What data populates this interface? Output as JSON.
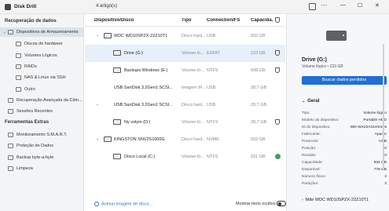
{
  "app": {
    "title": "Disk Drill",
    "articles": "4 artigo(s)"
  },
  "sidebar": {
    "sections": [
      {
        "label": "Recuperação de dados"
      },
      {
        "label": "Ferramentas Extras"
      }
    ],
    "items": [
      {
        "label": "Dispositivos de Armazenamento"
      },
      {
        "label": "Discos de hardware"
      },
      {
        "label": "Volumes Lógicos"
      },
      {
        "label": "RAIDs"
      },
      {
        "label": "NAS & Linux via SSH"
      },
      {
        "label": "Outro"
      },
      {
        "label": "Recuperação Avançada da Câm..."
      },
      {
        "label": "Sessões Recentes"
      },
      {
        "label": "Monitoramento S.M.A.R.T."
      },
      {
        "label": "Proteção de Dados"
      },
      {
        "label": "Backup byte-a-byte"
      },
      {
        "label": "Limpeza"
      }
    ]
  },
  "table": {
    "headers": {
      "device": "Dispositivo/Disco",
      "type": "Tipo",
      "connection": "Connection/FS",
      "capacity": "Capacida..."
    },
    "rows": [
      {
        "name": "WDC WD10SPZX-22Z10T1",
        "type": "Disco hard...",
        "conn": "USB",
        "cap": "932 GB"
      },
      {
        "name": "Drive (G:)",
        "type": "Volume ló...",
        "conn": "EXFAT",
        "cap": "233 GB"
      },
      {
        "name": "Backups Windows (E:)",
        "type": "Volume ló...",
        "conn": "NTFS",
        "cap": "698 GB"
      },
      {
        "name": "USB  SanDisk 3.2Gen1 SCSI...",
        "type": "Imagem M...",
        "conn": "USB",
        "cap": "28,7 GB"
      },
      {
        "name": "USB  SanDisk 3.2Gen1 SCSI...",
        "type": "Disco hard...",
        "conn": "USB",
        "cap": "28,7 GB"
      },
      {
        "name": "Ny volym (D:)",
        "type": "Volume ló...",
        "conn": "NTFS",
        "cap": "28,7 GB"
      },
      {
        "name": "KINGSTON SNV2S1000G",
        "type": "Disco hard...",
        "conn": "NVME",
        "cap": "932 GB"
      },
      {
        "name": "Disco Local (C:)",
        "type": "Volume ló...",
        "conn": "NTFS",
        "cap": "931 GB"
      }
    ],
    "add_image": "Anexar imagem de disco...",
    "show_hidden": "Mostrar itens ocultos"
  },
  "detail": {
    "title": "Drive (G:)",
    "subtitle": "Volume lógico • 233 GB",
    "button": "Buscar dados perdidos",
    "section": "Geral",
    "props": [
      {
        "k": "Tipo:",
        "v": "Volume lógico"
      },
      {
        "k": "Modelo do dispositivo:",
        "v": "Portable HDD"
      },
      {
        "k": "ID do dispositivo:",
        "v": "WD-WX22A31HS4X5"
      },
      {
        "k": "Fabricante:",
        "v": "Apacer"
      },
      {
        "k": "Protocolo:",
        "v": "USB"
      },
      {
        "k": "Posição:",
        "v": "0"
      },
      {
        "k": "Revisão:",
        "v": "0"
      },
      {
        "k": "Capacidade:",
        "v": "932 GB"
      },
      {
        "k": "Disponível:",
        "v": "779 GB"
      },
      {
        "k": "Número físico:",
        "v": "2"
      },
      {
        "k": "Partições:",
        "v": "3"
      }
    ],
    "parent": "Mãe  WDC WD10SPZX-22Z10T1"
  }
}
